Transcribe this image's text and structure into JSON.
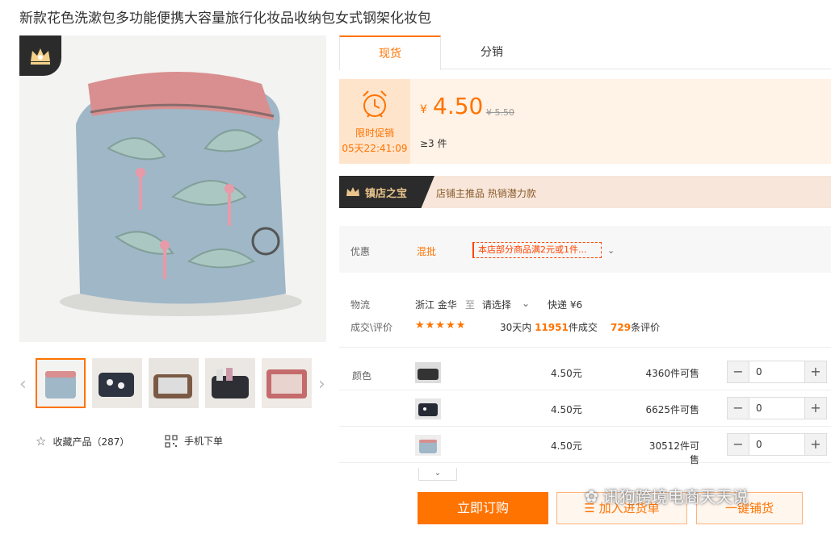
{
  "product": {
    "title": "新款花色洗漱包多功能便携大容量旅行化妆品收纳包女式钢架化妆包"
  },
  "gallery": {
    "thumb_count": 5,
    "favorite_label": "收藏产品（287）",
    "mobile_label": "手机下单"
  },
  "tabs": [
    {
      "label": "现货",
      "active": true
    },
    {
      "label": "分销",
      "active": false
    }
  ],
  "price": {
    "promo_label": "限时促销",
    "timer": "05天22:41:09",
    "currency": "¥",
    "current": "4.50",
    "original": "¥ 5.50",
    "moq": "≥3 件"
  },
  "treasure": {
    "badge": "镇店之宝",
    "text": "店铺主推品  热销潜力款"
  },
  "promotion": {
    "label": "优惠",
    "wholesale": "混批",
    "coupon": "本店部分商品满2元或1件..."
  },
  "logistics": {
    "label": "物流",
    "origin": "浙江 金华",
    "to": "至",
    "destination": "请选择",
    "shipping": "快递 ¥6"
  },
  "trade": {
    "label": "成交\\评价",
    "rating_stars": 5,
    "stars_text": "★★★★★",
    "deals_prefix": "30天内",
    "deals_count": "11951",
    "deals_suffix": "件成交",
    "reviews_count": "729",
    "reviews_suffix": "条评价"
  },
  "sku": {
    "label": "颜色",
    "rows": [
      {
        "price": "4.50元",
        "stock": "4360件可售",
        "qty": "0"
      },
      {
        "price": "4.50元",
        "stock": "6625件可售",
        "qty": "0"
      },
      {
        "price": "4.50元",
        "stock": "30512件可售",
        "qty": "0"
      }
    ]
  },
  "actions": {
    "order": "立即订购",
    "cart": "加入进货单",
    "dropship": "一键铺货"
  },
  "watermark": "讯狗跨境电商天天说",
  "colors": {
    "accent": "#ff7300",
    "price_bg": "#fff2e6"
  }
}
